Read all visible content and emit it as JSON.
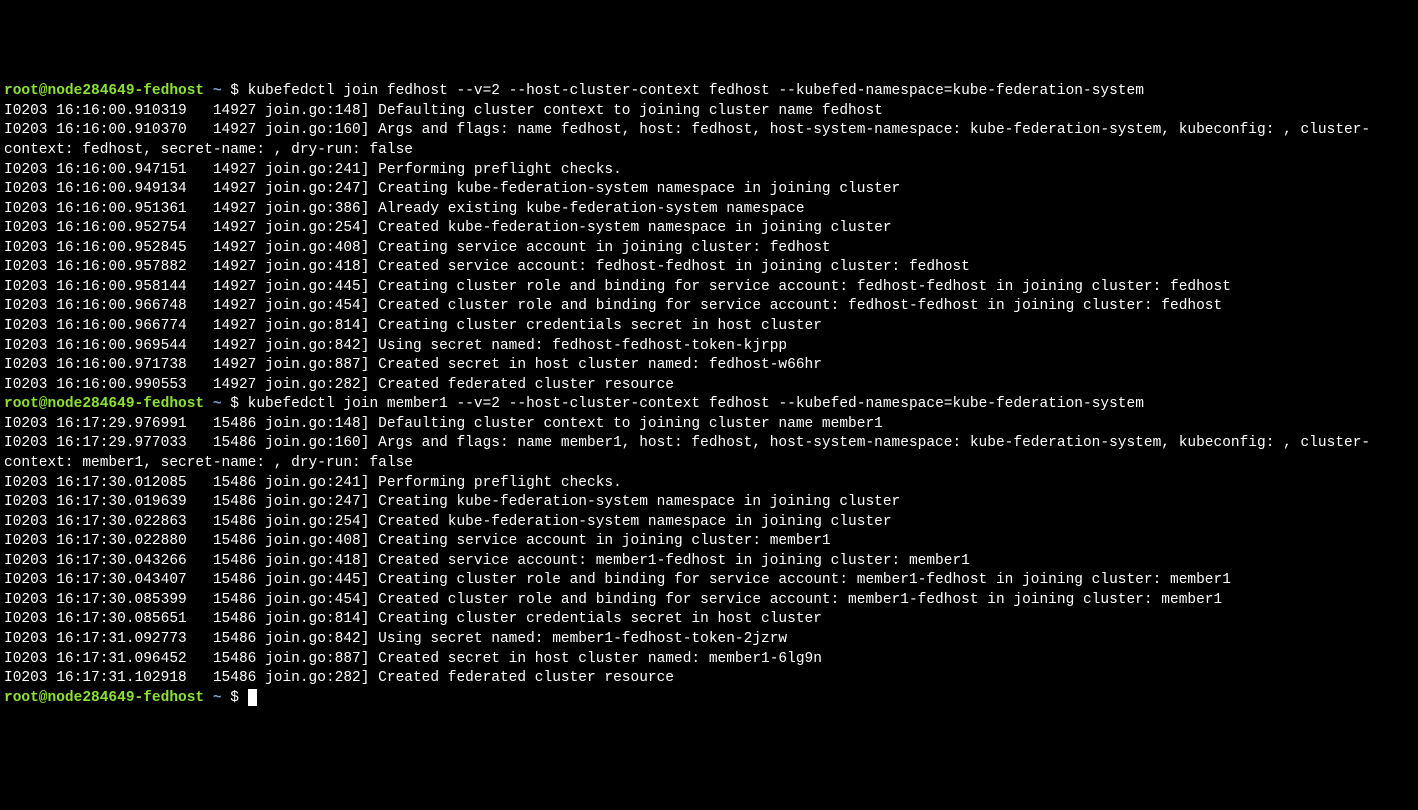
{
  "blocks": [
    {
      "prompt": {
        "user": "root@node284649-fedhost",
        "tilde": "~",
        "dollar": "$"
      },
      "command": "kubefedctl join fedhost --v=2 --host-cluster-context fedhost --kubefed-namespace=kube-federation-system",
      "output": [
        "I0203 16:16:00.910319   14927 join.go:148] Defaulting cluster context to joining cluster name fedhost",
        "I0203 16:16:00.910370   14927 join.go:160] Args and flags: name fedhost, host: fedhost, host-system-namespace: kube-federation-system, kubeconfig: , cluster-context: fedhost, secret-name: , dry-run: false",
        "I0203 16:16:00.947151   14927 join.go:241] Performing preflight checks.",
        "I0203 16:16:00.949134   14927 join.go:247] Creating kube-federation-system namespace in joining cluster",
        "I0203 16:16:00.951361   14927 join.go:386] Already existing kube-federation-system namespace",
        "I0203 16:16:00.952754   14927 join.go:254] Created kube-federation-system namespace in joining cluster",
        "I0203 16:16:00.952845   14927 join.go:408] Creating service account in joining cluster: fedhost",
        "I0203 16:16:00.957882   14927 join.go:418] Created service account: fedhost-fedhost in joining cluster: fedhost",
        "I0203 16:16:00.958144   14927 join.go:445] Creating cluster role and binding for service account: fedhost-fedhost in joining cluster: fedhost",
        "I0203 16:16:00.966748   14927 join.go:454] Created cluster role and binding for service account: fedhost-fedhost in joining cluster: fedhost",
        "I0203 16:16:00.966774   14927 join.go:814] Creating cluster credentials secret in host cluster",
        "I0203 16:16:00.969544   14927 join.go:842] Using secret named: fedhost-fedhost-token-kjrpp",
        "I0203 16:16:00.971738   14927 join.go:887] Created secret in host cluster named: fedhost-w66hr",
        "I0203 16:16:00.990553   14927 join.go:282] Created federated cluster resource"
      ]
    },
    {
      "prompt": {
        "user": "root@node284649-fedhost",
        "tilde": "~",
        "dollar": "$"
      },
      "command": "kubefedctl join member1 --v=2 --host-cluster-context fedhost --kubefed-namespace=kube-federation-system",
      "output": [
        "I0203 16:17:29.976991   15486 join.go:148] Defaulting cluster context to joining cluster name member1",
        "I0203 16:17:29.977033   15486 join.go:160] Args and flags: name member1, host: fedhost, host-system-namespace: kube-federation-system, kubeconfig: , cluster-context: member1, secret-name: , dry-run: false",
        "I0203 16:17:30.012085   15486 join.go:241] Performing preflight checks.",
        "I0203 16:17:30.019639   15486 join.go:247] Creating kube-federation-system namespace in joining cluster",
        "I0203 16:17:30.022863   15486 join.go:254] Created kube-federation-system namespace in joining cluster",
        "I0203 16:17:30.022880   15486 join.go:408] Creating service account in joining cluster: member1",
        "I0203 16:17:30.043266   15486 join.go:418] Created service account: member1-fedhost in joining cluster: member1",
        "I0203 16:17:30.043407   15486 join.go:445] Creating cluster role and binding for service account: member1-fedhost in joining cluster: member1",
        "I0203 16:17:30.085399   15486 join.go:454] Created cluster role and binding for service account: member1-fedhost in joining cluster: member1",
        "I0203 16:17:30.085651   15486 join.go:814] Creating cluster credentials secret in host cluster",
        "I0203 16:17:31.092773   15486 join.go:842] Using secret named: member1-fedhost-token-2jzrw",
        "I0203 16:17:31.096452   15486 join.go:887] Created secret in host cluster named: member1-6lg9n",
        "I0203 16:17:31.102918   15486 join.go:282] Created federated cluster resource"
      ]
    }
  ],
  "final_prompt": {
    "user": "root@node284649-fedhost",
    "tilde": "~",
    "dollar": "$"
  }
}
